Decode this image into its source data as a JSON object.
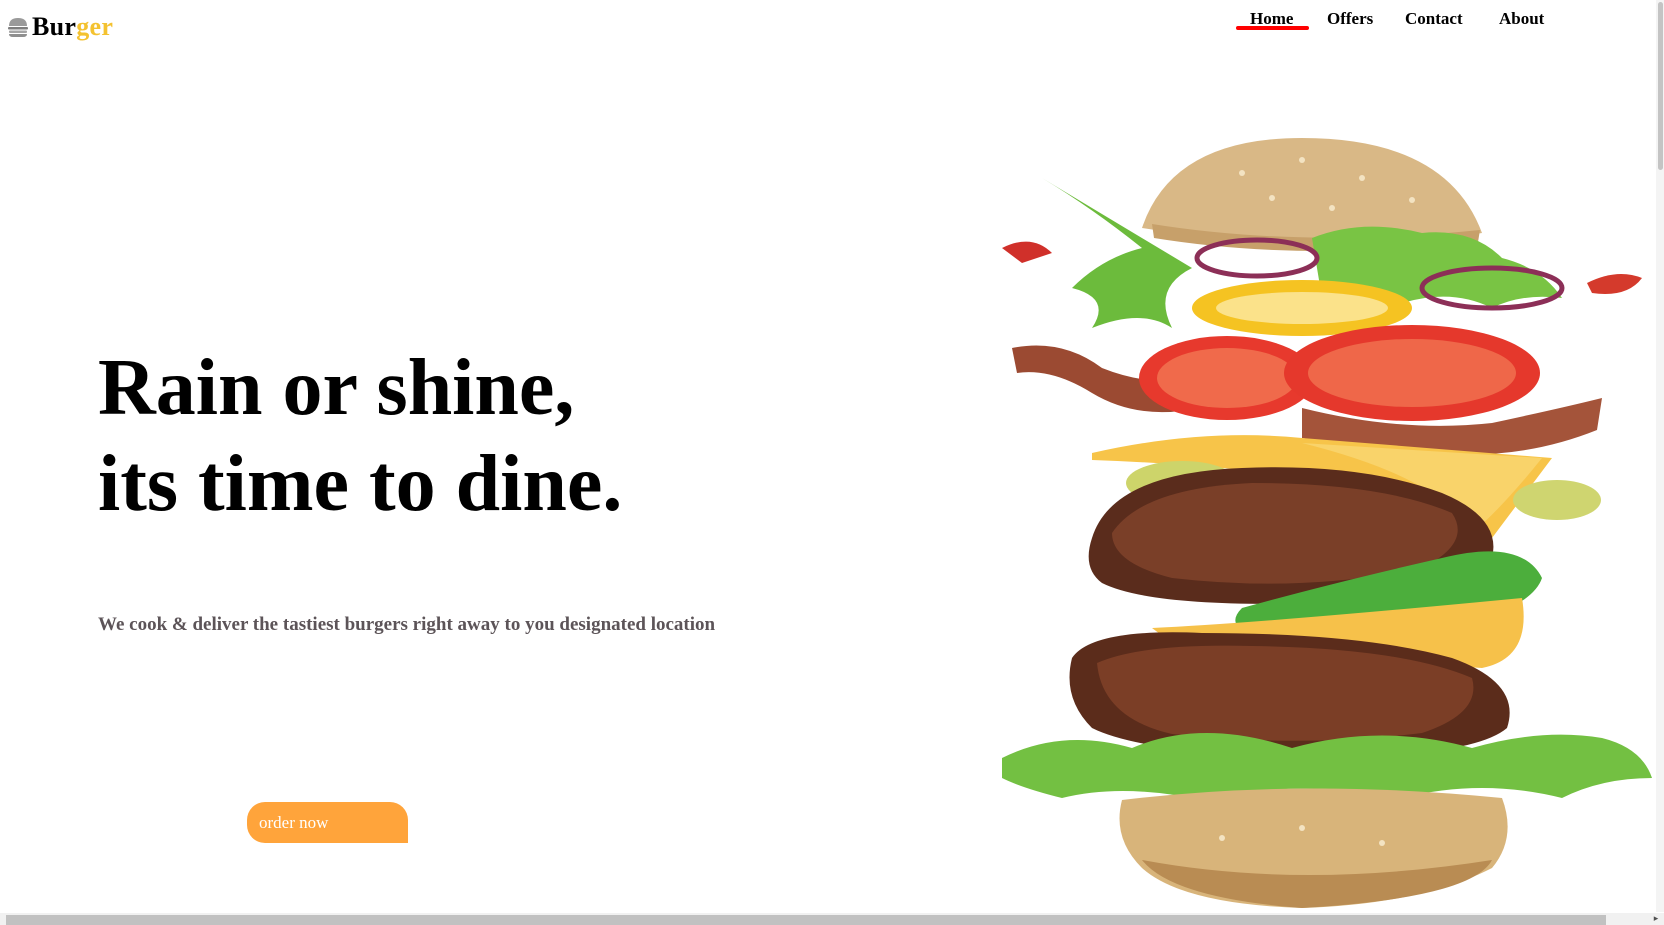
{
  "header": {
    "logo_part1": "Bur",
    "logo_part2": "ger",
    "logo_icon": "burger-icon",
    "nav": [
      {
        "label": "Home",
        "active": true
      },
      {
        "label": "Offers",
        "active": false
      },
      {
        "label": "Contact",
        "active": false
      },
      {
        "label": "About",
        "active": false
      }
    ]
  },
  "hero": {
    "headline_line1": "Rain or shine,",
    "headline_line2": "its time to dine.",
    "subtitle": "We cook & deliver the tastiest burgers right away to you designated location",
    "button_label": "order now",
    "image": "exploded-burger-image"
  },
  "colors": {
    "accent_yellow": "#f4c230",
    "active_underline": "#ff0000",
    "button": "#ffa43b",
    "subtitle": "#5c5458"
  },
  "scrollbar": {
    "right_arrow_icon": "▸"
  }
}
